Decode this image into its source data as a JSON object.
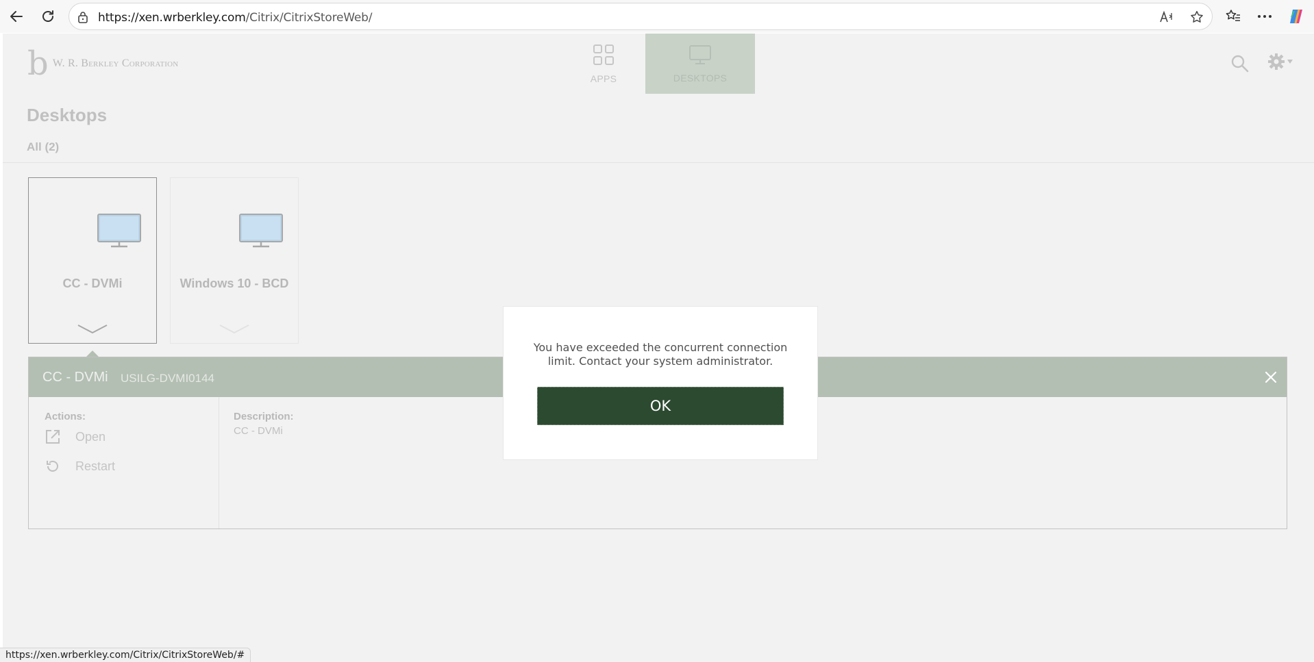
{
  "browser": {
    "url_host": "https://xen.wrberkley.com",
    "url_path": "/Citrix/CitrixStoreWeb/",
    "status_url": "https://xen.wrberkley.com/Citrix/CitrixStoreWeb/#",
    "icons": [
      "back-icon",
      "refresh-icon",
      "site-info-icon",
      "read-aloud-icon",
      "favorite-icon",
      "favorites-list-icon",
      "more-icon",
      "copilot-icon"
    ]
  },
  "header": {
    "logo_letter": "b",
    "logo_text": "W. R. Berkley Corporation",
    "nav": [
      {
        "label": "APPS",
        "icon": "apps-grid-icon",
        "active": false
      },
      {
        "label": "DESKTOPS",
        "icon": "monitor-icon",
        "active": true
      }
    ]
  },
  "main": {
    "title": "Desktops",
    "filter": "All (2)",
    "tiles": [
      {
        "name": "CC - DVMi",
        "selected": true
      },
      {
        "name": "Windows 10 - BCD",
        "selected": false
      }
    ]
  },
  "details": {
    "name": "CC - DVMi",
    "host": "USILG-DVMI0144",
    "actions_label": "Actions:",
    "actions": [
      {
        "label": "Open",
        "icon": "open-external-icon"
      },
      {
        "label": "Restart",
        "icon": "restart-icon"
      }
    ],
    "description_label": "Description:",
    "description": "CC - DVMi"
  },
  "modal": {
    "message": "You have exceeded the concurrent connection limit. Contact your system administrator.",
    "ok_label": "OK"
  },
  "colors": {
    "accent_dark": "#2c4a30",
    "bar_green": "#b3bfb2",
    "nav_active": "#c8d2c7"
  }
}
